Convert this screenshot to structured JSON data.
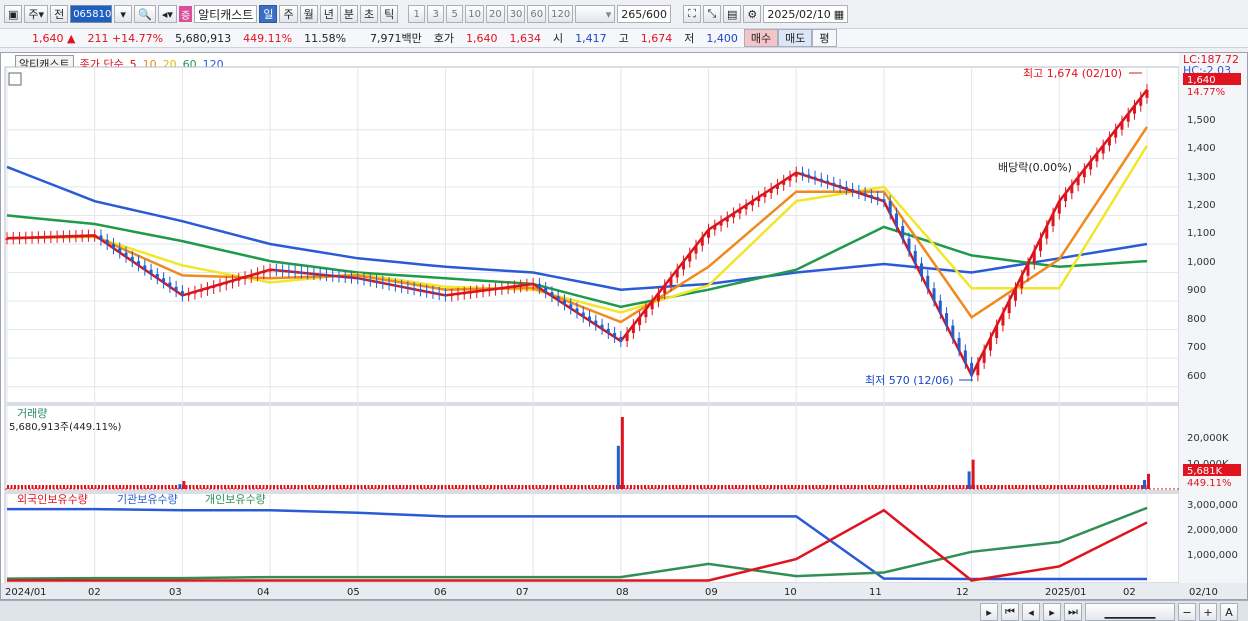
{
  "toolbar": {
    "market": "주",
    "prev_label": "전",
    "code": "065810",
    "badge": "증",
    "name": "알티캐스트",
    "periods": [
      "일",
      "주",
      "월",
      "년",
      "분",
      "초",
      "틱"
    ],
    "intervals": [
      "1",
      "3",
      "5",
      "10",
      "20",
      "30",
      "60",
      "120"
    ],
    "count": "265",
    "count_total": "/600",
    "date": "2025/02/10"
  },
  "quote": {
    "price": "1,640",
    "price_arrow": "▲",
    "change": "211",
    "change_pct": "+14.77%",
    "volume": "5,680,913",
    "volume_ratio": "449.11%",
    "turnover": "11.58%",
    "amount": "7,971백만",
    "hoga_label": "호가",
    "ask": "1,640",
    "bid": "1,634",
    "open_label": "시",
    "open": "1,417",
    "high_label": "고",
    "high": "1,674",
    "low_label": "저",
    "low": "1,400",
    "buy_label": "매수",
    "sell_label": "매도",
    "avg_label": "평"
  },
  "price_panel": {
    "stock_name": "알티캐스트",
    "ma_type_label": "종가 단순",
    "ma_periods": [
      "5",
      "10",
      "20",
      "60",
      "120"
    ],
    "ma_colors": [
      "#d8141c",
      "#f08a1e",
      "#f2e62a",
      "#1f9a4a",
      "#2a5bd7"
    ],
    "lc_label": "LC:187.72",
    "hc_label": "HC:-2.03",
    "last_price_tag": "1,640",
    "last_pct_tag": "14.77%",
    "high_annotation": "최고 1,674 (02/10)",
    "low_annotation": "최저 570 (12/06)",
    "dividend_annotation": "배당락(0.00%)",
    "y_ticks": [
      "1,500",
      "1,400",
      "1,300",
      "1,200",
      "1,100",
      "1,000",
      "900",
      "800",
      "700",
      "600"
    ]
  },
  "volume_panel": {
    "title": "거래량",
    "value_label": "5,680,913주(449.11%)",
    "y_ticks": [
      "20,000K",
      "10,000K"
    ],
    "last_tag": "5,681K",
    "last_pct_tag": "449.11%"
  },
  "holdings_panel": {
    "series_names": [
      "외국인보유수량",
      "기관보유수량",
      "개인보유수량"
    ],
    "series_colors": [
      "#e0141e",
      "#2a5bd7",
      "#2f8f55"
    ],
    "y_ticks": [
      "3,000,000",
      "2,000,000",
      "1,000,000"
    ]
  },
  "x_axis": {
    "labels": [
      "2024/01",
      "02",
      "03",
      "04",
      "05",
      "06",
      "07",
      "08",
      "09",
      "10",
      "11",
      "12",
      "2025/01",
      "02",
      "02/10"
    ]
  },
  "chart_data": {
    "type": "candlestick",
    "x": [
      "2024/01",
      "02",
      "03",
      "04",
      "05",
      "06",
      "07",
      "08",
      "09",
      "10",
      "11",
      "12",
      "2025/01",
      "02/10"
    ],
    "price_close_approx": [
      1120,
      1130,
      920,
      1010,
      980,
      920,
      960,
      760,
      1150,
      1350,
      1250,
      640,
      1250,
      1640
    ],
    "ma120_approx": [
      1370,
      1250,
      1180,
      1100,
      1050,
      1020,
      1000,
      940,
      960,
      1000,
      1030,
      1000,
      1050,
      1100
    ],
    "ma60_approx": [
      1200,
      1170,
      1110,
      1040,
      1000,
      980,
      960,
      880,
      940,
      1010,
      1160,
      1060,
      1020,
      1040
    ],
    "volume_k_spikes": [
      {
        "x": "03",
        "v": 3000
      },
      {
        "x": "08",
        "v": 27000
      },
      {
        "x": "12",
        "v": 11000
      },
      {
        "x": "02/10",
        "v": 5681
      }
    ],
    "high": {
      "value": 1674,
      "date": "02/10"
    },
    "low": {
      "value": 570,
      "date": "12/06"
    },
    "ylim": [
      550,
      1720
    ]
  }
}
